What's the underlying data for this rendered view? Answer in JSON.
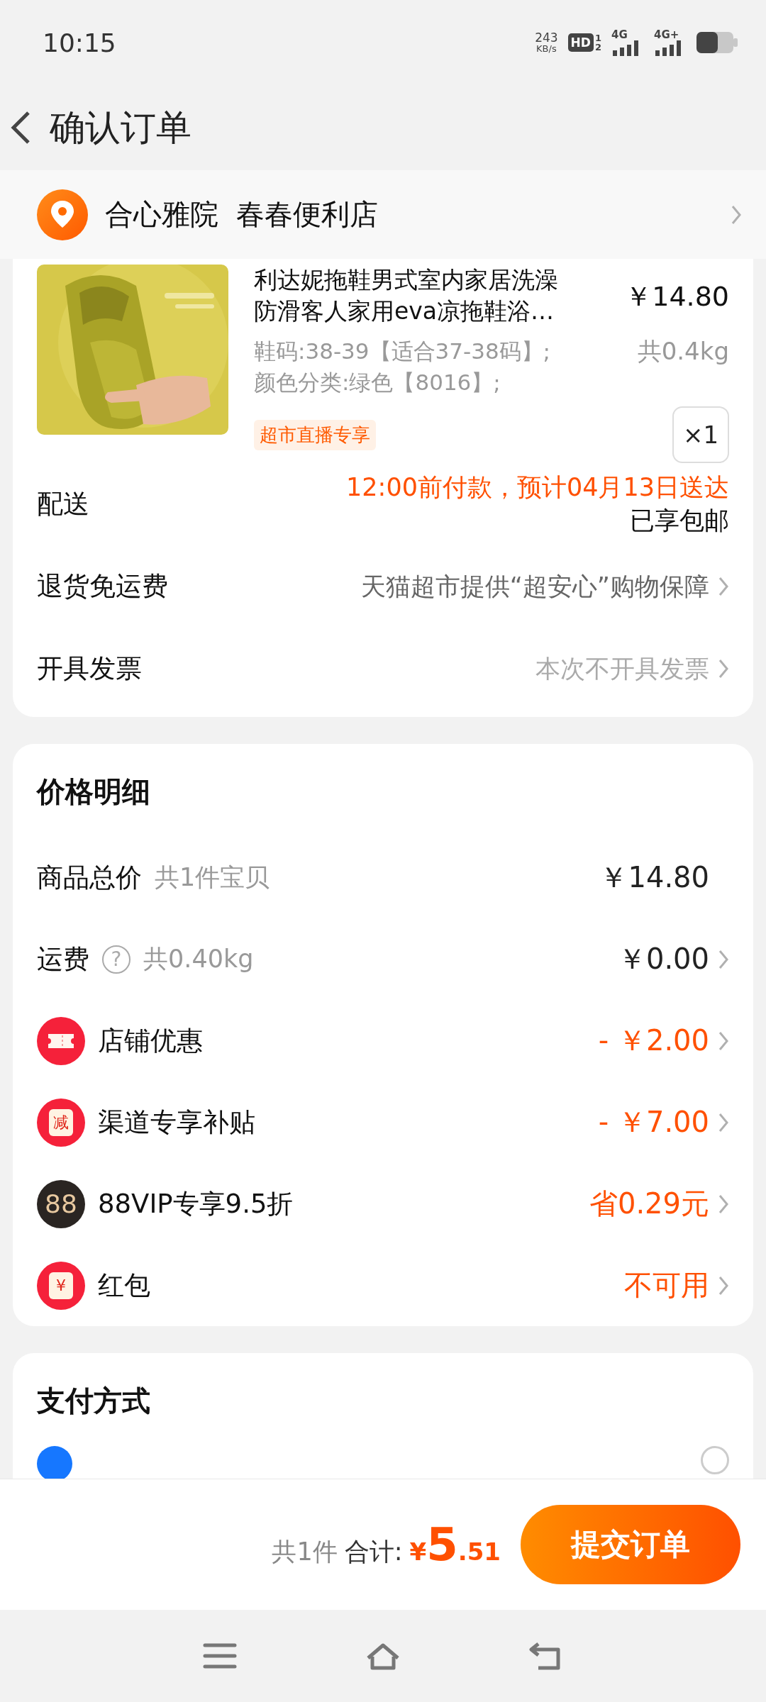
{
  "status_bar": {
    "time": "10:15",
    "net_speed": "243",
    "net_unit": "KB/s",
    "hd": "HD",
    "hd_sup": "1",
    "hd_sub": "2",
    "sim1": "4G",
    "sim2": "4G+"
  },
  "header": {
    "title": "确认订单"
  },
  "address": {
    "text": "合心雅院  春春便利店"
  },
  "product": {
    "title_lines": [
      "利达妮拖鞋男式室内家居洗澡",
      "防滑客人家用eva凉拖鞋浴…"
    ],
    "price": "￥14.80",
    "specs": [
      "鞋码:38-39【适合37-38码】;",
      "颜色分类:绿色【8016】;"
    ],
    "weight": "共0.4kg",
    "tag": "超市直播专享",
    "quantity": "×1"
  },
  "order_rows": [
    {
      "label": "配送",
      "value": "12:00前付款，预计04月13日送达",
      "note": "已享包邮",
      "color": "#ff5000",
      "arrow": false
    },
    {
      "label": "退货免运费",
      "value": "天猫超市提供“超安心”购物保障",
      "color": "#666666",
      "arrow": true
    },
    {
      "label": "开具发票",
      "value": "本次不开具发票",
      "color": "#aaaaaa",
      "arrow": true
    }
  ],
  "price_detail": {
    "title": "价格明细",
    "rows": [
      {
        "kind": "plain",
        "label": "商品总价",
        "sub": "共1件宝贝",
        "value": "￥14.80",
        "color": "#222222",
        "arrow": false
      },
      {
        "kind": "help",
        "label": "运费",
        "help": "?",
        "sub": "共0.40kg",
        "value": "￥0.00",
        "color": "#222222",
        "arrow": true
      },
      {
        "kind": "ticket",
        "label": "店铺优惠",
        "value": "- ￥2.00",
        "color": "#ff5000",
        "arrow": true
      },
      {
        "kind": "stamp",
        "icon_text": "减",
        "label": "渠道专享补贴",
        "value": "- ￥7.00",
        "color": "#ff5000",
        "arrow": true
      },
      {
        "kind": "vip",
        "icon_text": "88",
        "label": "88VIP专享9.5折",
        "value": "省0.29元",
        "color": "#ff5000",
        "arrow": true
      },
      {
        "kind": "envelope",
        "icon_text": "¥",
        "label": "红包",
        "value": "不可用",
        "color": "#ff5000",
        "arrow": true
      }
    ]
  },
  "payment": {
    "title": "支付方式",
    "selected": false
  },
  "footer": {
    "count": "共1件",
    "total_label": "合计:",
    "currency": "¥",
    "total_int": "5",
    "total_dec": ".51",
    "submit": "提交订单"
  }
}
